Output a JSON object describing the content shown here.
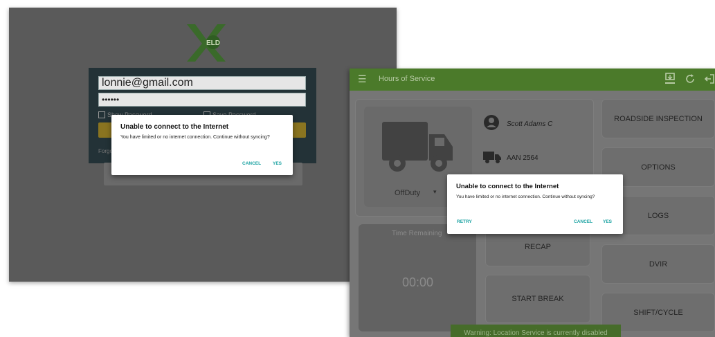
{
  "login_screen": {
    "logo_text": "ELD",
    "email_value": "lonnie@gmail.com",
    "password_value": "••••••",
    "show_password_label": "Show Password",
    "save_password_label": "Save Password",
    "forgot_label": "Forgot",
    "dialog": {
      "title": "Unable to connect to the Internet",
      "message": "You have limited or no internet connection. Continue without syncing?",
      "cancel_label": "CANCEL",
      "yes_label": "YES"
    }
  },
  "hos_screen": {
    "app_title": "Hours of Service",
    "driver_name": "Scott Adams C",
    "vehicle_id": "AAN 2564",
    "duty_status": "OffDuty",
    "time_remaining_label": "Time Remaining",
    "timer_value": "00:00",
    "buttons": {
      "roadside": "ROADSIDE INSPECTION",
      "options": "OPTIONS",
      "logs": "LOGS",
      "dvir": "DVIR",
      "shift_cycle": "SHIFT/CYCLE",
      "recap": "RECAP",
      "start_break": "START BREAK"
    },
    "toast": "Warning: Location Service is currently disabled",
    "dialog": {
      "title": "Unable to connect to the Internet",
      "message": "You have limited or no internet connection. Continue without syncing?",
      "retry_label": "RETRY",
      "cancel_label": "CANCEL",
      "yes_label": "YES"
    }
  },
  "colors": {
    "appbar": "#4b7a2a",
    "dialog_button": "#1aa2a2",
    "logo_green": "#3a7a2a"
  },
  "icons": [
    "menu-icon",
    "download-icon",
    "refresh-icon",
    "logout-icon",
    "person-icon",
    "truck-icon",
    "dropdown-caret-icon"
  ]
}
